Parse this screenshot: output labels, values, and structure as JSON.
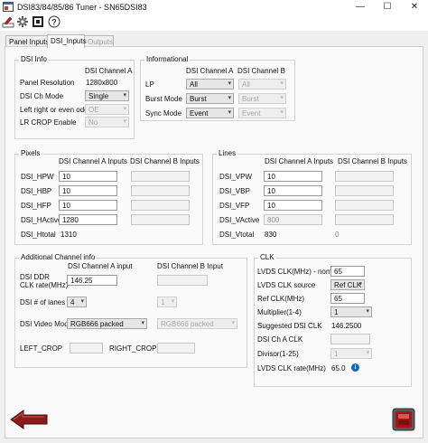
{
  "window": {
    "title": "DSI83/84/85/86 Tuner - SN65DSI83",
    "minimize": "—",
    "maximize": "☐",
    "close": "✕"
  },
  "tabs": [
    {
      "label": "Panel Inputs"
    },
    {
      "label": "DSI_Inputs"
    },
    {
      "label": "Outputs"
    }
  ],
  "dsi_info": {
    "title": "DSI Info",
    "col_header": "DSI Channel A",
    "panel_resolution_label": "Panel Resolution",
    "panel_resolution_value": "1280x800",
    "ch_mode_label": "DSI Ch Mode",
    "ch_mode_value": "Single",
    "left_right_label": "Left right or even odd",
    "left_right_value": "OE",
    "lr_crop_label": "LR CROP Enable",
    "lr_crop_value": "No"
  },
  "informational": {
    "title": "Informational",
    "col_a": "DSI Channel A",
    "col_b": "DSI Channel B",
    "rows": [
      {
        "label": "LP",
        "a": "All",
        "b": "All"
      },
      {
        "label": "Burst Mode",
        "a": "Burst",
        "b": "Burst"
      },
      {
        "label": "Sync Mode",
        "a": "Event",
        "b": "Event"
      }
    ]
  },
  "pixels": {
    "title": "Pixels",
    "col_a": "DSI Channel A Inputs",
    "col_b": "DSI Channel B Inputs",
    "rows": [
      {
        "label": "DSI_HPW",
        "a": "10"
      },
      {
        "label": "DSI_HBP",
        "a": "10"
      },
      {
        "label": "DSI_HFP",
        "a": "10"
      },
      {
        "label": "DSI_HActive",
        "a": "1280"
      },
      {
        "label": "DSI_Htotal",
        "a": "1310"
      }
    ]
  },
  "lines": {
    "title": "Lines",
    "col_a": "DSI Channel A Inputs",
    "col_b": "DSI Channel B Inputs",
    "rows": [
      {
        "label": "DSI_VPW",
        "a": "10"
      },
      {
        "label": "DSI_VBP",
        "a": "10"
      },
      {
        "label": "DSI_VFP",
        "a": "10"
      },
      {
        "label": "DSI_VActive",
        "a": "800"
      },
      {
        "label": "DSI_Vtotal",
        "a": "830",
        "b": "0"
      }
    ]
  },
  "additional": {
    "title": "Additional Channel info",
    "col_a": "DSI Channel A input",
    "col_b": "DSI Channel B Input",
    "ddr_label_1": "DSI DDR",
    "ddr_label_2": "CLK rate(MHz)",
    "ddr_a": "146.25",
    "lanes_label": "DSI # of lanes",
    "lanes_a": "4",
    "lanes_b": "1",
    "video_mode_label": "DSI Video Mode",
    "video_mode_a": "RGB666 packed",
    "video_mode_b": "RGB666 packed",
    "left_crop_label": "LEFT_CROP",
    "right_crop_label": "RIGHT_CROP"
  },
  "clk": {
    "title": "CLK",
    "lvds_nominal_label": "LVDS CLK(MHz) - nominal",
    "lvds_nominal_value": "65",
    "lvds_source_label": "LVDS CLK source",
    "lvds_source_value": "Ref CLK",
    "ref_clk_label": "Ref CLK(MHz)",
    "ref_clk_value": "65",
    "multiplier_label": "Multiplier(1-4)",
    "multiplier_value": "1",
    "suggested_label": "Suggested DSI CLK",
    "suggested_value": "146.2500",
    "ch_a_clk_label": "DSI Ch A CLK",
    "divisor_label": "Divisor(1-25)",
    "divisor_value": "1",
    "lvds_rate_label": "LVDS CLK rate(MHz)",
    "lvds_rate_value": "65.0"
  },
  "colors": {
    "back_arrow": "#8b1a1a",
    "info": "#1565c0",
    "exit": "#a31515"
  }
}
